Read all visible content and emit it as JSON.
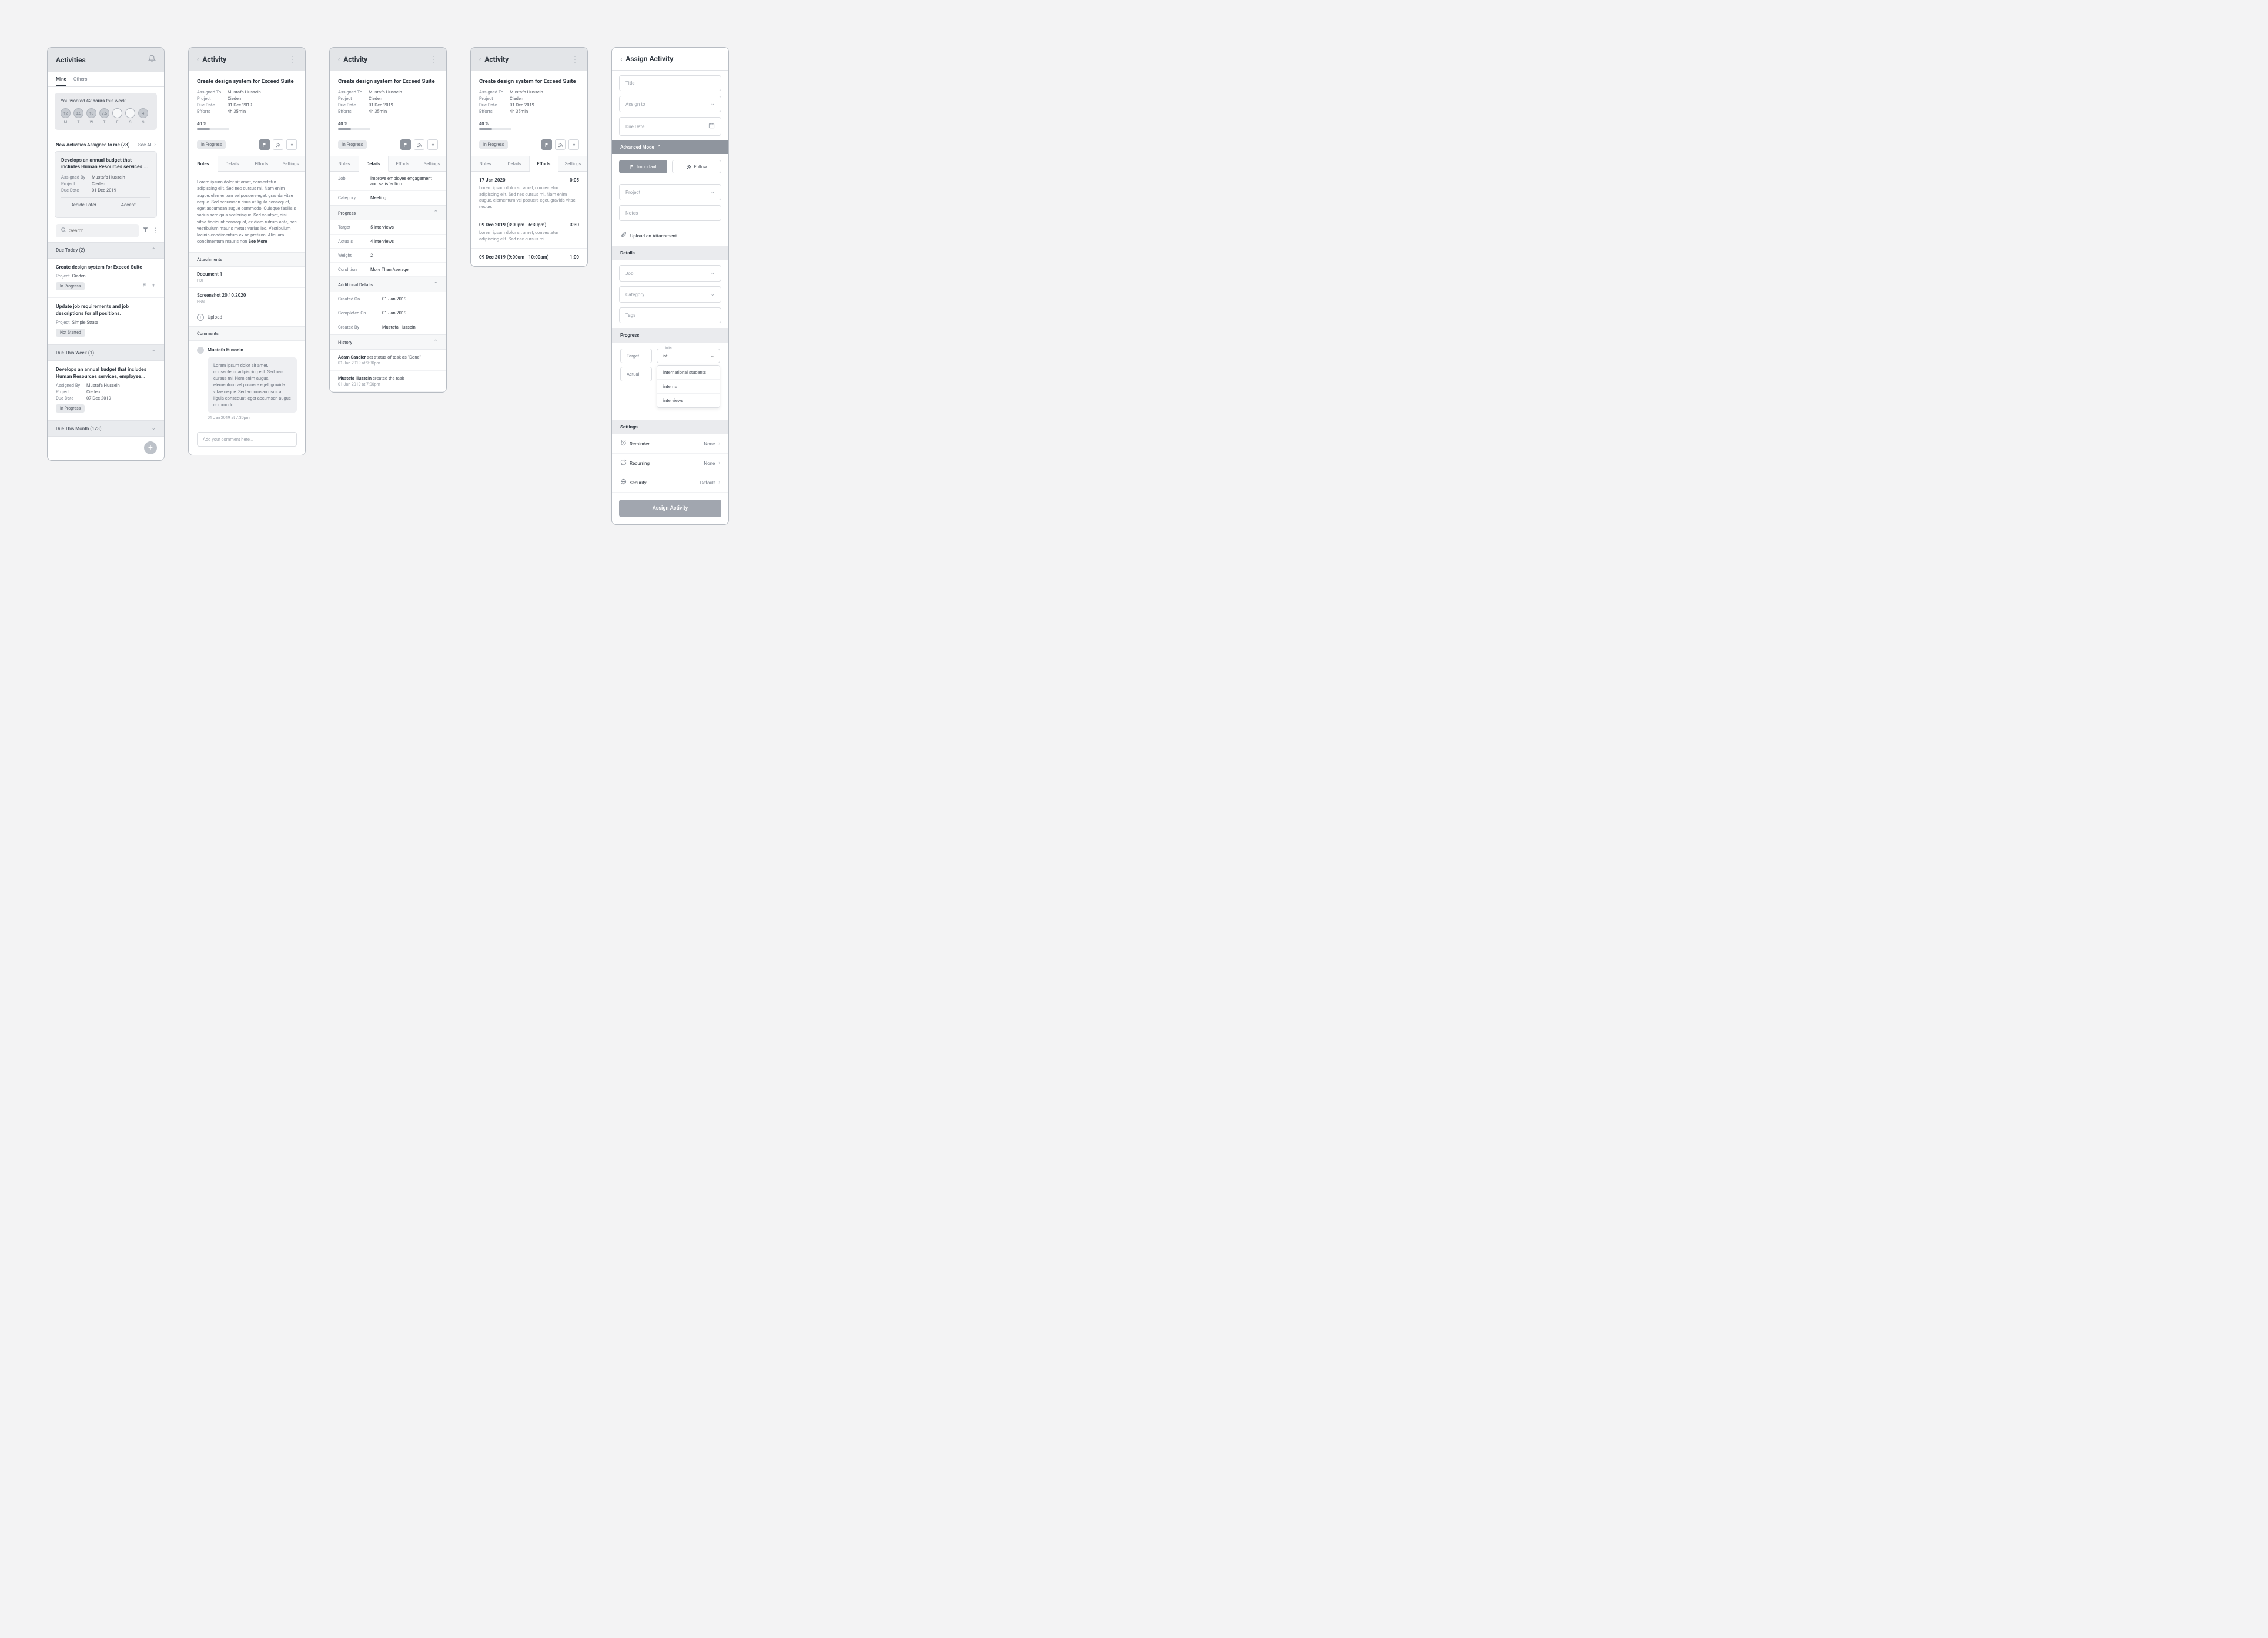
{
  "p1": {
    "title": "Activities",
    "tabs": {
      "mine": "Mine",
      "others": "Others"
    },
    "worked": {
      "pre": "You worked ",
      "bold": "42 hours",
      "post": " this week"
    },
    "days": [
      {
        "v": "12",
        "l": "M"
      },
      {
        "v": "8.5",
        "l": "T"
      },
      {
        "v": "10",
        "l": "W"
      },
      {
        "v": "7.5",
        "l": "T"
      },
      {
        "v": "",
        "l": "F"
      },
      {
        "v": "",
        "l": "S"
      },
      {
        "v": "4",
        "l": "S"
      }
    ],
    "new_assign": {
      "label": "New Activities Assigned to me (23)",
      "see_all": "See All"
    },
    "card": {
      "title": "Develops an annual budget that includes Human Resources services ...",
      "assigned_by_l": "Assigned By",
      "assigned_by_v": "Mustafa Hussein",
      "project_l": "Project",
      "project_v": "Cieden",
      "due_l": "Due Date",
      "due_v": "01 Dec 2019",
      "decide": "Decide Later",
      "accept": "Accept"
    },
    "search_ph": "Search",
    "sec_today": "Due Today (2)",
    "t1": {
      "title": "Create design system for Exceed Suite",
      "proj_l": "Project",
      "proj_v": "Cieden",
      "status": "In Progress"
    },
    "t2": {
      "title": "Update job requirements and job descriptions for all positions.",
      "proj_l": "Project",
      "proj_v": "Simple Strata",
      "status": "Not Started"
    },
    "sec_week": "Due This Week (1)",
    "t3": {
      "title": "Develops an annual budget that includes Human Resources services, employee...",
      "assigned_by_l": "Assigned By",
      "assigned_by_v": "Mustafa Hussein",
      "project_l": "Project",
      "project_v": "Cieden",
      "due_l": "Due Date",
      "due_v": "07 Dec 2019",
      "status": "In Progress"
    },
    "sec_month": "Due This Month (123)"
  },
  "act": {
    "title": "Activity",
    "task_title": "Create design system for Exceed Suite",
    "assigned_l": "Assigned To",
    "assigned_v": "Mustafa Hussein",
    "project_l": "Project",
    "project_v": "Cieden",
    "due_l": "Due Date",
    "due_v": "01 Dec 2019",
    "efforts_l": "Efforts",
    "efforts_v": "4h 35min",
    "progress": "40 %",
    "status": "In Progress",
    "tabs": {
      "notes": "Notes",
      "details": "Details",
      "efforts": "Efforts",
      "settings": "Settings"
    }
  },
  "p2": {
    "notes": "Lorem ipsum dolor sit amet, consectetur adipiscing elit. Sed nec cursus mi. Nam enim augue, elementum vel posuere eget, gravida vitae neque. Sed accumsan risus at ligula consequat, eget accumsan augue commodo. Quisque facilisis varius sem quis scelerisque. Sed volutpat, nisi vitae tincidunt consequat, ex diam rutrum ante, nec vestibulum mauris metus varius leo. Vestibulum lacinia condimentum ex ac pretium. Aliquam condimentum mauris non ",
    "see_more": "See More",
    "attachments_h": "Attachments",
    "att1_n": "Document 1",
    "att1_t": "PDF",
    "att2_n": "Screenshot 20.10.2020",
    "att2_t": "PNG",
    "upload": "Upload",
    "comments_h": "Comments",
    "commenter": "Mustafa Hussein",
    "comment_body": "Lorem ipsum dolor sit amet, consectetur adipiscing elit. Sed nec cursus mi. Nam enim augue, elementum vel posuere eget, gravida vitae neque. Sed accumsan risus at ligula consequat, eget accumsan augue commodo.",
    "comment_ts": "01 Jan 2019 at 7:30pm",
    "comment_ph": "Add your comment here..."
  },
  "p3": {
    "job_l": "Job",
    "job_v": "Improve employee engagement and satisfaction",
    "cat_l": "Category",
    "cat_v": "Meeting",
    "prog_h": "Progress",
    "target_l": "Target",
    "target_v": "5 interviews",
    "actuals_l": "Actuals",
    "actuals_v": "4 interviews",
    "weight_l": "Weight",
    "weight_v": "2",
    "cond_l": "Condition",
    "cond_v": "More Than Average",
    "add_h": "Additional Details",
    "created_on_l": "Created On",
    "created_on_v": "01 Jan 2019",
    "completed_on_l": "Completed On",
    "completed_on_v": "01 Jan 2019",
    "created_by_l": "Created By",
    "created_by_v": "Mustafa Hussein",
    "hist_h": "History",
    "h1_a": "Adam Sandler",
    "h1_b": " set status of task as \"Done\"",
    "h1_ts": "01 Jan 2019 at 9:30pm",
    "h2_a": "Mustafa Hussein",
    "h2_b": " created the task",
    "h2_ts": "01 Jan 2019 at 7:00pm"
  },
  "p4": {
    "e1_d": "17 Jan 2020",
    "e1_t": "0:05",
    "e1_desc": "Lorem ipsum dolor sit amet, consectetur adipiscing elit. Sed nec cursus mi. Nam enim augue, elementum vel posuere eget, gravida vitae neque.",
    "e2_d": "09 Dec 2019 (3:00pm - 6:30pm)",
    "e2_t": "3:30",
    "e2_desc": "Lorem ipsum dolor sit amet, consectetur adipiscing elit. Sed nec cursus mi.",
    "e3_d": "09 Dec 2019 (9:00am - 10:00am)",
    "e3_t": "1:00"
  },
  "p5": {
    "title": "Assign Activity",
    "f_title": "Title",
    "f_assign": "Assign to",
    "f_due": "Due Date",
    "adv": "Advanced Mode",
    "important": "Important",
    "follow": "Follow",
    "f_project": "Project",
    "f_notes": "Notes",
    "upload_att": "Upload an Attachment",
    "details_h": "Details",
    "f_job": "Job",
    "f_category": "Category",
    "f_tags": "Tags",
    "progress_h": "Progress",
    "target": "Target",
    "actual": "Actual",
    "units_label": "Units",
    "units_input": "int",
    "dd1": "international students",
    "dd2": "interns",
    "dd3": "interviews",
    "settings_h": "Settings",
    "s_reminder": "Reminder",
    "s_reminder_v": "None",
    "s_recurring": "Recurring",
    "s_recurring_v": "None",
    "s_security": "Security",
    "s_security_v": "Default",
    "submit": "Assign Activity"
  }
}
